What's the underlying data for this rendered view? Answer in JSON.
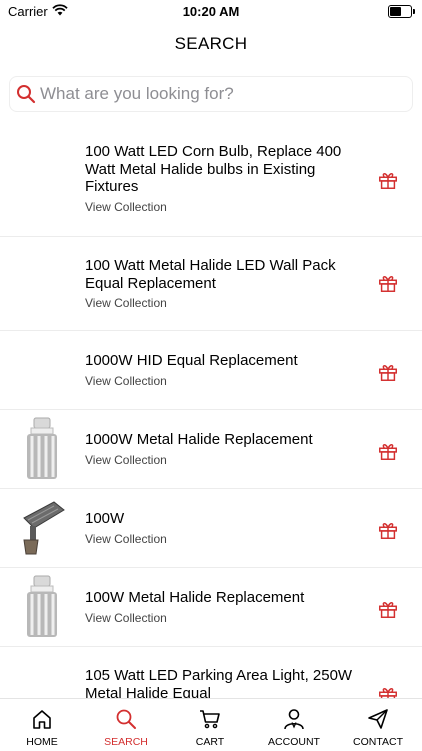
{
  "status_bar": {
    "carrier": "Carrier",
    "time": "10:20 AM",
    "battery_level": 0.6
  },
  "header": {
    "title": "SEARCH"
  },
  "search": {
    "placeholder": "What are you looking for?",
    "value": ""
  },
  "results": [
    {
      "name": "100 Watt LED Corn Bulb, Replace 400 Watt Metal Halide bulbs in Existing Fixtures",
      "sub": "View Collection",
      "thumb": ""
    },
    {
      "name": "100 Watt Metal Halide LED Wall Pack Equal Replacement",
      "sub": "View Collection",
      "thumb": ""
    },
    {
      "name": "1000W HID Equal Replacement",
      "sub": "View Collection",
      "thumb": ""
    },
    {
      "name": "1000W Metal Halide Replacement",
      "sub": "View Collection",
      "thumb": "corn-bulb"
    },
    {
      "name": "100W",
      "sub": "View Collection",
      "thumb": "flood-light"
    },
    {
      "name": "100W Metal Halide Replacement",
      "sub": "View Collection",
      "thumb": "corn-bulb"
    },
    {
      "name": "105 Watt LED Parking Area Light, 250W Metal Halide Equal",
      "sub": "",
      "thumb": ""
    }
  ],
  "tabs": [
    {
      "label": "HOME",
      "icon": "home-icon",
      "active": false
    },
    {
      "label": "SEARCH",
      "icon": "search-icon",
      "active": true
    },
    {
      "label": "CART",
      "icon": "cart-icon",
      "active": false
    },
    {
      "label": "ACCOUNT",
      "icon": "account-icon",
      "active": false
    },
    {
      "label": "CONTACT",
      "icon": "send-icon",
      "active": false
    }
  ],
  "colors": {
    "accent": "#d32f2f",
    "text": "#000000",
    "divider": "#ececec"
  }
}
